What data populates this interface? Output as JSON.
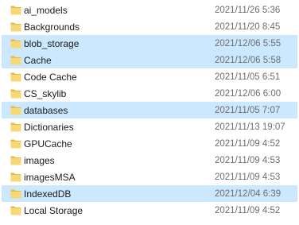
{
  "colors": {
    "selection": "#cce8ff",
    "folder_body": "#f8d775",
    "folder_back": "#e8b84a",
    "name_text": "#1a1a1a",
    "date_text": "#6d6d6d"
  },
  "files": [
    {
      "name": "ai_models",
      "date": "2021/11/26 5:36",
      "selected": false,
      "icon": "folder-icon"
    },
    {
      "name": "Backgrounds",
      "date": "2021/11/20 8:45",
      "selected": false,
      "icon": "folder-icon"
    },
    {
      "name": "blob_storage",
      "date": "2021/12/06 5:55",
      "selected": true,
      "icon": "folder-icon"
    },
    {
      "name": "Cache",
      "date": "2021/12/06 5:58",
      "selected": true,
      "icon": "folder-icon"
    },
    {
      "name": "Code Cache",
      "date": "2021/11/05 6:51",
      "selected": false,
      "icon": "folder-icon"
    },
    {
      "name": "CS_skylib",
      "date": "2021/12/06 6:00",
      "selected": false,
      "icon": "folder-icon"
    },
    {
      "name": "databases",
      "date": "2021/11/05 7:07",
      "selected": true,
      "icon": "folder-icon"
    },
    {
      "name": "Dictionaries",
      "date": "2021/11/13 19:07",
      "selected": false,
      "icon": "folder-icon"
    },
    {
      "name": "GPUCache",
      "date": "2021/11/09 4:52",
      "selected": false,
      "icon": "folder-icon"
    },
    {
      "name": "images",
      "date": "2021/11/09 4:53",
      "selected": false,
      "icon": "folder-icon"
    },
    {
      "name": "imagesMSA",
      "date": "2021/11/09 4:53",
      "selected": false,
      "icon": "folder-icon"
    },
    {
      "name": "IndexedDB",
      "date": "2021/12/04 6:39",
      "selected": true,
      "icon": "folder-icon"
    },
    {
      "name": "Local Storage",
      "date": "2021/11/09 4:52",
      "selected": false,
      "icon": "folder-icon"
    }
  ]
}
